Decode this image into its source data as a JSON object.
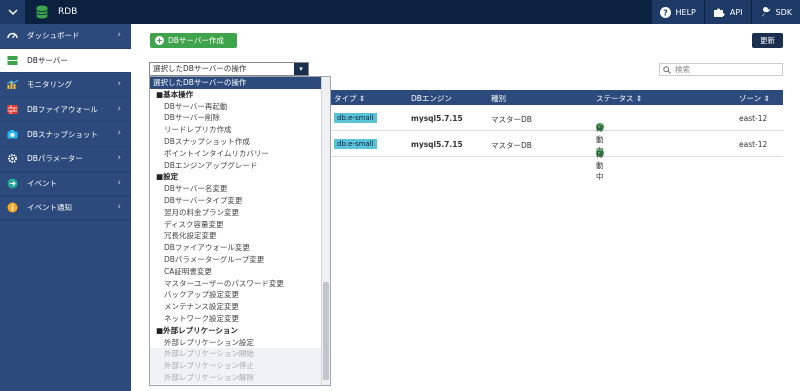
{
  "topbar": {
    "app_title": "RDB",
    "help_label": "HELP",
    "api_label": "API",
    "sdk_label": "SDK"
  },
  "sidebar": {
    "items": [
      {
        "label": "ダッシュボード",
        "icon": "dashboard-icon"
      },
      {
        "label": "DBサーバー",
        "icon": "db-server-icon"
      },
      {
        "label": "モニタリング",
        "icon": "monitoring-icon"
      },
      {
        "label": "DBファイアウォール",
        "icon": "firewall-icon"
      },
      {
        "label": "DBスナップショット",
        "icon": "camera-icon"
      },
      {
        "label": "DBパラメーター",
        "icon": "gear-icon"
      },
      {
        "label": "イベント",
        "icon": "event-icon"
      },
      {
        "label": "イベント通知",
        "icon": "info-icon"
      }
    ]
  },
  "main": {
    "create_button": "DBサーバー作成",
    "refresh_button": "更新",
    "select_value": "選択したDBサーバーの操作",
    "search_placeholder": "検索",
    "columns": {
      "type": "タイプ",
      "engine": "DBエンジン",
      "kind": "種別",
      "status": "ステータス",
      "zone": "ゾーン"
    },
    "rows": [
      {
        "type": "db.e-small",
        "engine": "mysql5.7.15",
        "kind": "マスターDB",
        "status": "稼動中",
        "zone": "east-12"
      },
      {
        "type": "db.e-small",
        "engine": "mysql5.7.15",
        "kind": "マスターDB",
        "status": "稼動中",
        "zone": "east-12"
      }
    ]
  },
  "dropdown": {
    "header": "選択したDBサーバーの操作",
    "groups": [
      {
        "title": "■基本操作",
        "items": [
          "DBサーバー再起動",
          "DBサーバー削除",
          "リードレプリカ作成",
          "DBスナップショット作成",
          "ポイントインタイムリカバリー",
          "DBエンジンアップグレード"
        ]
      },
      {
        "title": "■設定",
        "items": [
          "DBサーバー名変更",
          "DBサーバータイプ変更",
          "翌月の料金プラン変更",
          "ディスク容量変更",
          "冗長化設定変更",
          "DBファイアウォール変更",
          "DBパラメーターグループ変更",
          "CA証明書変更",
          "マスターユーザーのパスワード変更",
          "バックアップ設定変更",
          "メンテナンス設定変更",
          "ネットワーク設定変更"
        ]
      },
      {
        "title": "■外部レプリケーション",
        "items": [
          "外部レプリケーション設定"
        ],
        "disabled_items": [
          "外部レプリケーション開始",
          "外部レプリケーション停止",
          "外部レプリケーション解除"
        ]
      }
    ]
  },
  "colors": {
    "topbar": "#0b2140",
    "sidebar": "#2c4a7c",
    "accent_green": "#3ea34a",
    "tag_teal": "#59c3d6"
  }
}
